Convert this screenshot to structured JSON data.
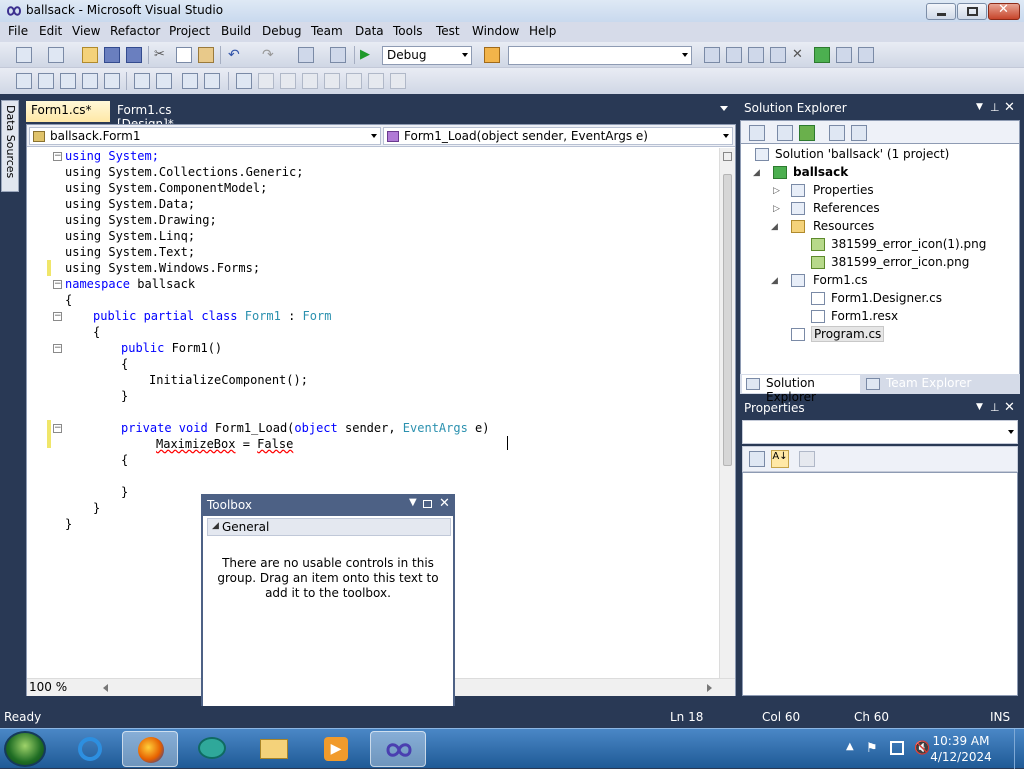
{
  "window": {
    "title": "ballsack - Microsoft Visual Studio"
  },
  "menu": [
    "File",
    "Edit",
    "View",
    "Refactor",
    "Project",
    "Build",
    "Debug",
    "Team",
    "Data",
    "Tools",
    "Test",
    "Window",
    "Help"
  ],
  "toolbar": {
    "config_value": "Debug",
    "platform_value": ""
  },
  "left_strip": {
    "data_sources_label": "Data Sources"
  },
  "doc_tabs": [
    {
      "label": "Form1.cs*",
      "active": true
    },
    {
      "label": "Form1.cs [Design]*",
      "active": false
    }
  ],
  "editor": {
    "class_combo": "ballsack.Form1",
    "member_combo": "Form1_Load(object sender, EventArgs e)",
    "zoom": "100 %",
    "lines": {
      "l1": "using System;",
      "l2": "using System.Collections.Generic;",
      "l3": "using System.ComponentModel;",
      "l4": "using System.Data;",
      "l5": "using System.Drawing;",
      "l6": "using System.Linq;",
      "l7": "using System.Text;",
      "l8": "using System.Windows.Forms;",
      "l9_kw": "namespace",
      "l9_name": " ballsack",
      "l10": "{",
      "l11_kw": "public partial class",
      "l11_type": "Form1",
      "l11_sep": " : ",
      "l11_base": "Form",
      "l12": "{",
      "l13_kw": "public",
      "l13_rest": " Form1()",
      "l14": "{",
      "l15": "InitializeComponent();",
      "l16": "}",
      "l17_kw": "private void",
      "l17_name": " Form1_Load(",
      "l17_kw2": "object",
      "l17_mid": " sender, ",
      "l17_type": "EventArgs",
      "l17_end": " e)",
      "l18_a": "MaximizeBox",
      "l18_b": " = ",
      "l18_c": "False",
      "l19": "{",
      "l20": "}",
      "l21": "}",
      "l22": "}"
    }
  },
  "toolbox": {
    "title": "Toolbox",
    "group": "General",
    "message": "There are no usable controls in this group. Drag an item onto this text to add it to the toolbox."
  },
  "solution_explorer": {
    "title": "Solution Explorer",
    "items": {
      "solution": "Solution 'ballsack' (1 project)",
      "project": "ballsack",
      "properties": "Properties",
      "references": "References",
      "resources": "Resources",
      "res1": "381599_error_icon(1).png",
      "res2": "381599_error_icon.png",
      "form1": "Form1.cs",
      "form1_designer": "Form1.Designer.cs",
      "form1_resx": "Form1.resx",
      "program": "Program.cs"
    },
    "tabs": [
      "Solution Explorer",
      "Team Explorer"
    ]
  },
  "properties": {
    "title": "Properties"
  },
  "status": {
    "state": "Ready",
    "ln": "Ln 18",
    "col": "Col 60",
    "ch": "Ch 60",
    "mode": "INS"
  },
  "taskbar": {
    "time": "10:39 AM",
    "date": "4/12/2024"
  }
}
